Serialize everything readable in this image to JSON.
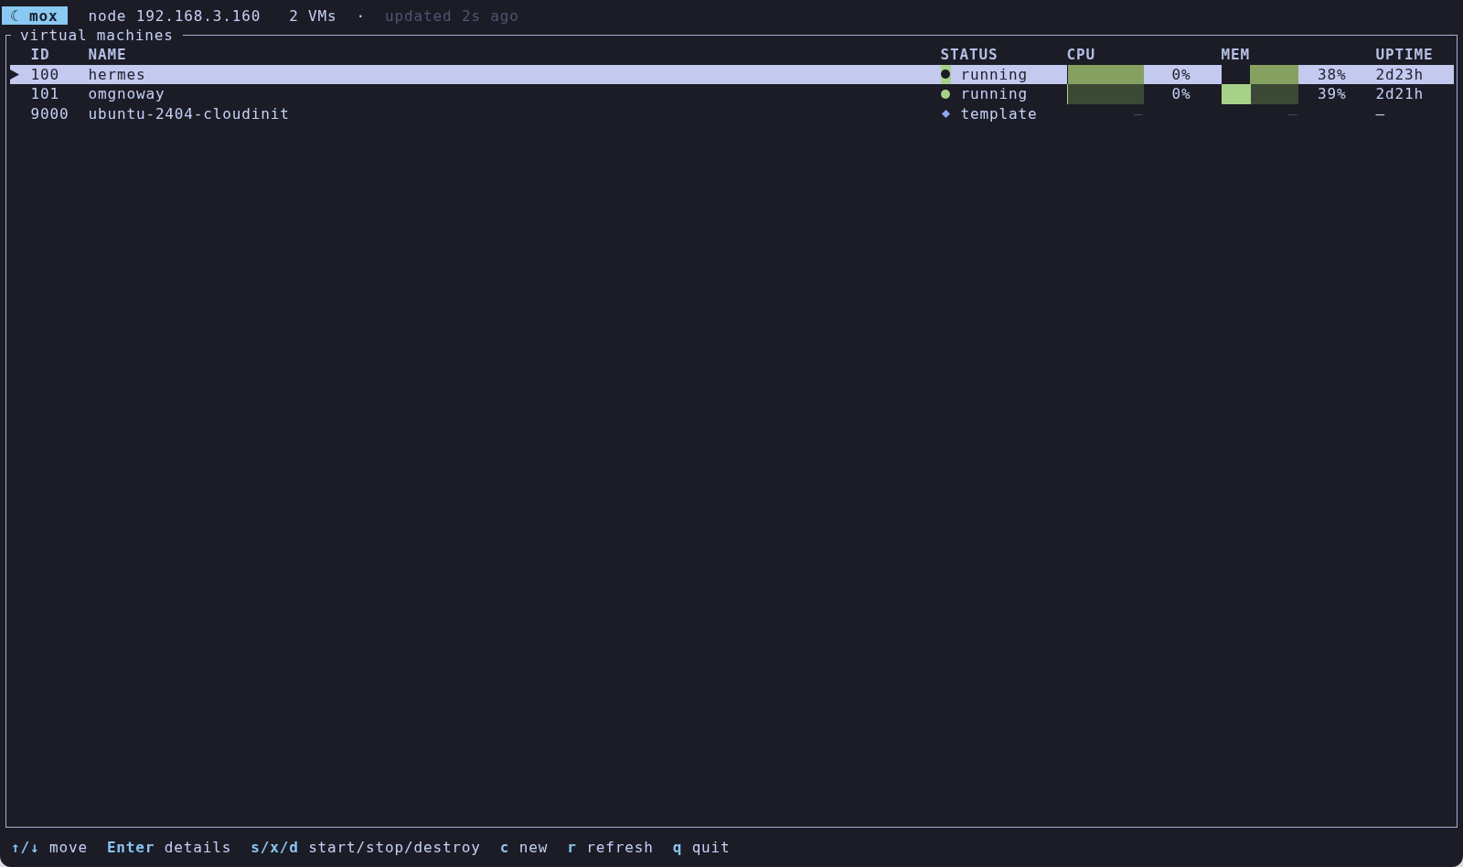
{
  "top_bar": {
    "badge": "☾ mox",
    "node": "node 192.168.3.160",
    "vm_count": "2 VMs",
    "separator": "·",
    "updated": "updated 2s ago"
  },
  "panel": {
    "title": "virtual machines",
    "columns": [
      "ID",
      "NAME",
      "STATUS",
      "CPU",
      "MEM",
      "UPTIME"
    ],
    "rows": [
      {
        "selected": true,
        "id": "100",
        "name": "hermes",
        "status": {
          "kind": "dot",
          "color": "#a6d189",
          "label": "running"
        },
        "cpu": {
          "kind": "meter",
          "level": 0,
          "reading": "0%"
        },
        "mem": {
          "kind": "meter",
          "level": 0.38,
          "reading": "38%"
        },
        "uptime": "2d23h"
      },
      {
        "selected": false,
        "id": "101",
        "name": "omgnoway",
        "status": {
          "kind": "dot",
          "color": "#a6d189",
          "label": "running"
        },
        "cpu": {
          "kind": "meter",
          "level": 0,
          "reading": "0%"
        },
        "mem": {
          "kind": "meter",
          "level": 0.39,
          "reading": "39%"
        },
        "uptime": "2d21h"
      },
      {
        "selected": false,
        "id": "9000",
        "name": "ubuntu-2404-cloudinit",
        "status": {
          "kind": "diamond",
          "color": "#8caaee",
          "label": "template"
        },
        "cpu": {
          "kind": "empty",
          "text": "—"
        },
        "mem": {
          "kind": "empty",
          "text": "—"
        },
        "uptime": "—"
      }
    ]
  },
  "footer": {
    "shortcuts": [
      {
        "key": "↑/↓",
        "action": "move"
      },
      {
        "key": "Enter",
        "action": "details"
      },
      {
        "key": "s/x/d",
        "action": "start/stop/destroy"
      },
      {
        "key": "c",
        "action": "new"
      },
      {
        "key": "r",
        "action": "refresh"
      },
      {
        "key": "q",
        "action": "quit"
      }
    ]
  }
}
